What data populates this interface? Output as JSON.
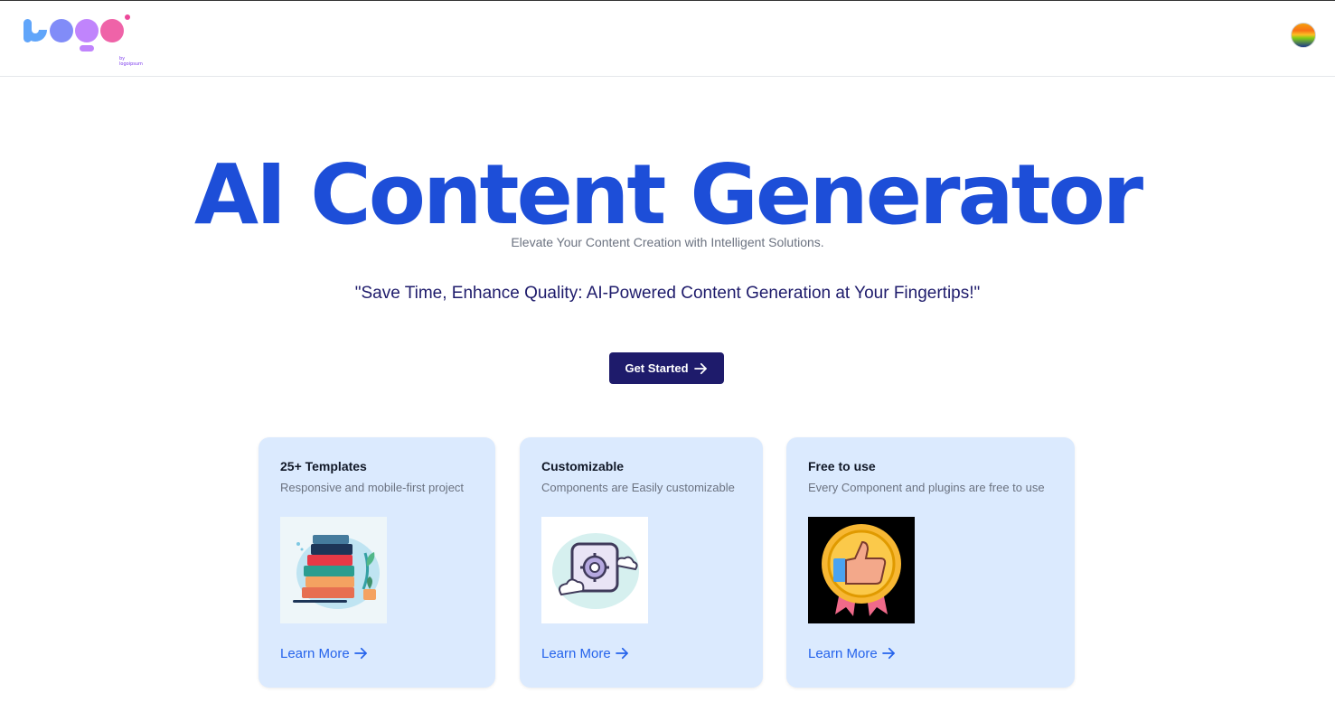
{
  "header": {
    "logo_text": "Logo",
    "logo_subtext": "by logoipsum",
    "avatar_icon": "user-avatar"
  },
  "hero": {
    "title": "AI Content Generator",
    "subtitle": "Elevate Your Content Creation with Intelligent Solutions.",
    "quote": "\"Save Time, Enhance Quality: AI-Powered Content Generation at Your Fingertips!\"",
    "cta_label": "Get Started"
  },
  "cards": [
    {
      "title": "25+ Templates",
      "description": "Responsive and mobile-first project",
      "image_icon": "books-illustration",
      "link_label": "Learn More"
    },
    {
      "title": "Customizable",
      "description": "Components are Easily customizable",
      "image_icon": "settings-cloud-illustration",
      "link_label": "Learn More"
    },
    {
      "title": "Free to use",
      "description": "Every Component and plugins are free to use",
      "image_icon": "thumbs-up-badge-illustration",
      "link_label": "Learn More"
    }
  ],
  "colors": {
    "primary_blue": "#1d4ed8",
    "navy": "#1e1b6b",
    "card_bg": "#dbeafe",
    "link": "#2563eb"
  }
}
